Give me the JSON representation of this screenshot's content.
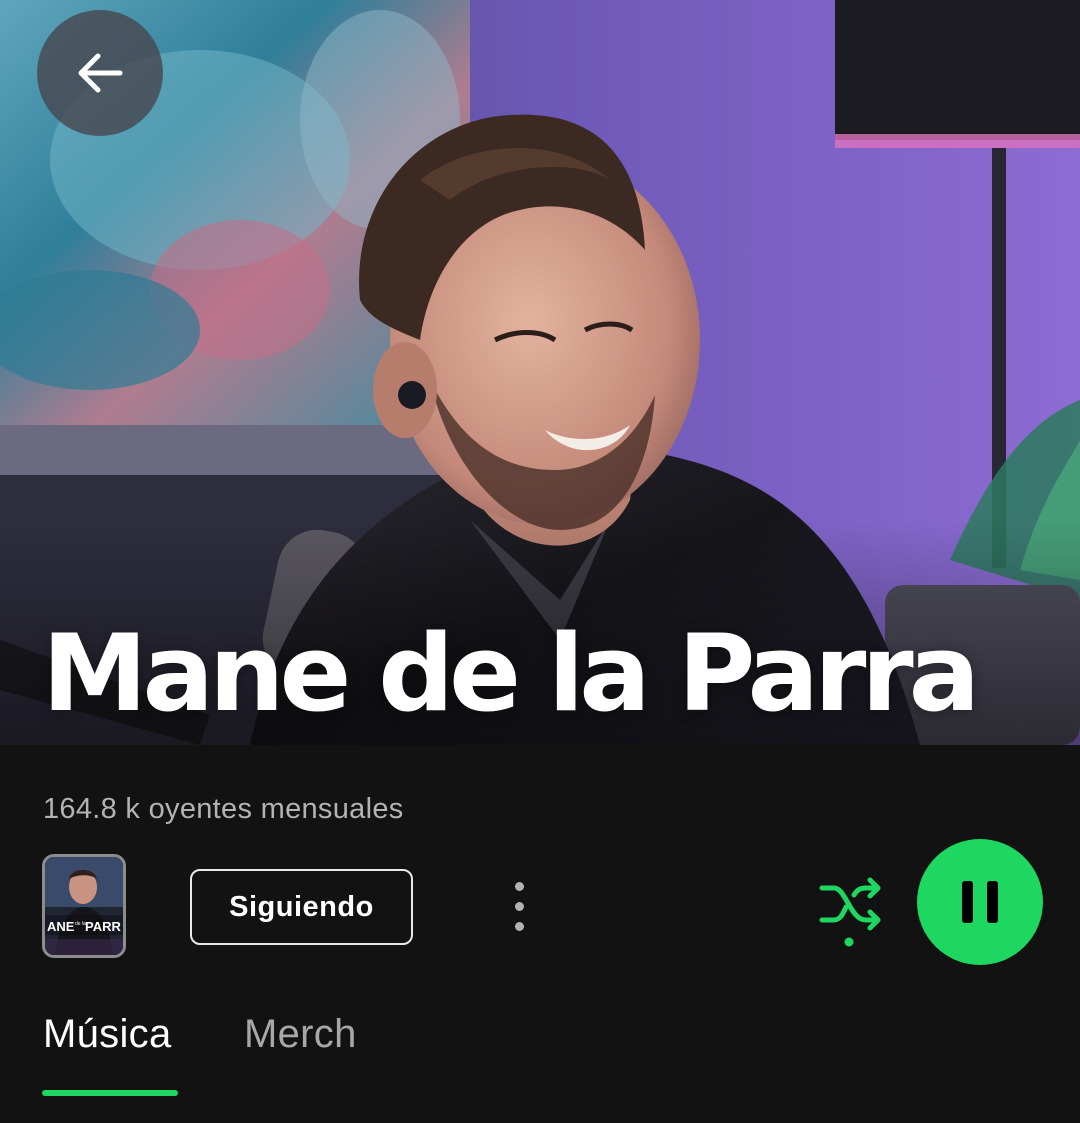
{
  "artist": {
    "name": "Mane de la Parra",
    "monthly_listeners": "164.8 k oyentes mensuales"
  },
  "header": {
    "back_icon": "arrow-left-icon"
  },
  "actions": {
    "release_thumb": {
      "text_left": "ANE",
      "text_small": "de la",
      "text_right": "PARR"
    },
    "follow_label": "Siguiendo",
    "more_icon": "more-vertical-icon",
    "shuffle_icon": "shuffle-icon",
    "play_icon": "pause-icon"
  },
  "tabs": [
    {
      "label": "Música",
      "selected": true
    },
    {
      "label": "Merch",
      "selected": false
    }
  ],
  "colors": {
    "accent": "#1ed760",
    "background": "#121212",
    "secondary_text": "#b3b3b3",
    "inactive_tab": "#a7a7a7"
  }
}
